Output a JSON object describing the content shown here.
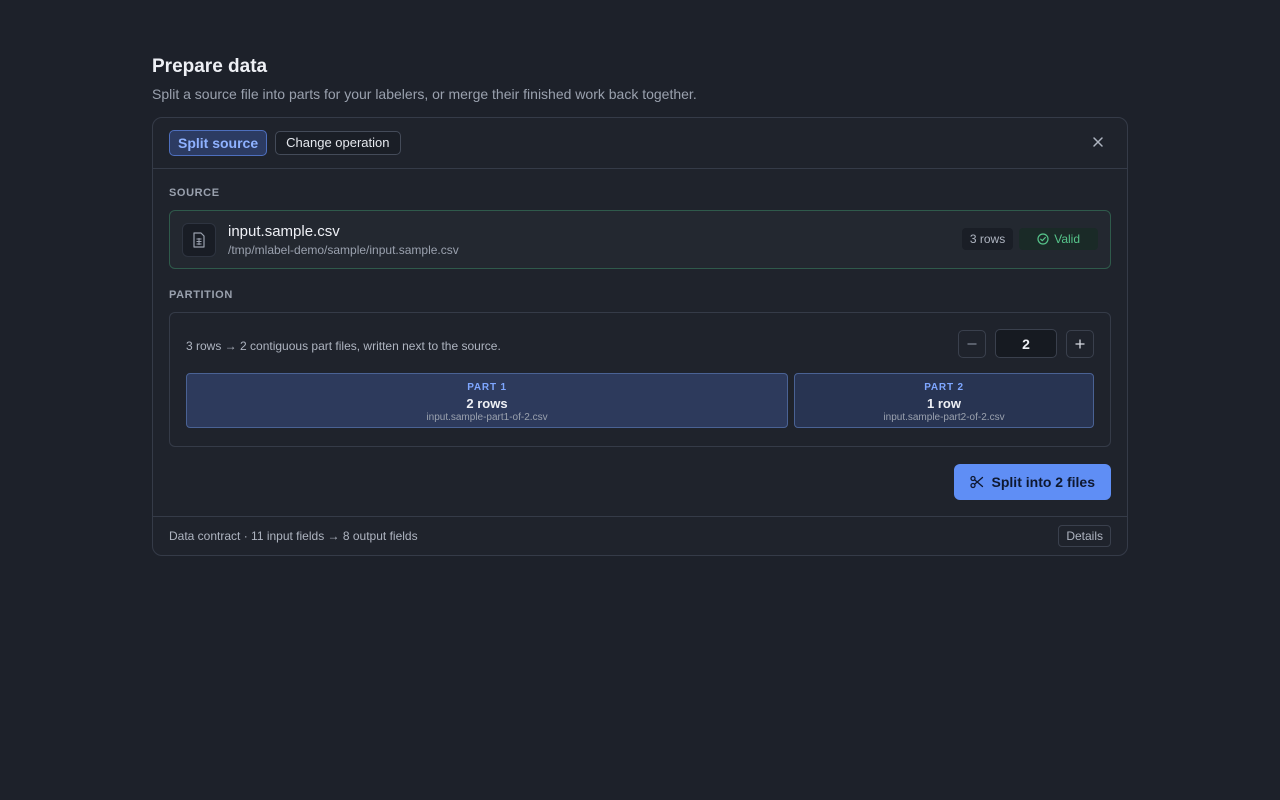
{
  "page": {
    "title": "Prepare data",
    "subtitle": "Split a source file into parts for your labelers, or merge their finished work back together."
  },
  "header": {
    "mode_label": "Split source",
    "change_label": "Change operation",
    "close_icon": "close-icon"
  },
  "source": {
    "section_label": "SOURCE",
    "file_name": "input.sample.csv",
    "file_path": "/tmp/mlabel-demo/sample/input.sample.csv",
    "rows_label": "3 rows",
    "status_label": "Valid",
    "status_color": "#56c48a",
    "file_icon": "file-text-icon"
  },
  "partition": {
    "section_label": "PARTITION",
    "description": "3 rows → 2 contiguous part files, written next to the source.",
    "count": "2",
    "parts": [
      {
        "label": "PART 1",
        "rows": "2 rows",
        "file": "input.sample-part1-of-2.csv"
      },
      {
        "label": "PART 2",
        "rows": "1 row",
        "file": "input.sample-part2-of-2.csv"
      }
    ]
  },
  "action": {
    "split_label": "Split into 2 files",
    "accent": "#5f8ef5",
    "icon": "scissors-icon"
  },
  "footer": {
    "contract_text": "Data contract · 11 input fields → 8 output fields",
    "details_label": "Details"
  }
}
